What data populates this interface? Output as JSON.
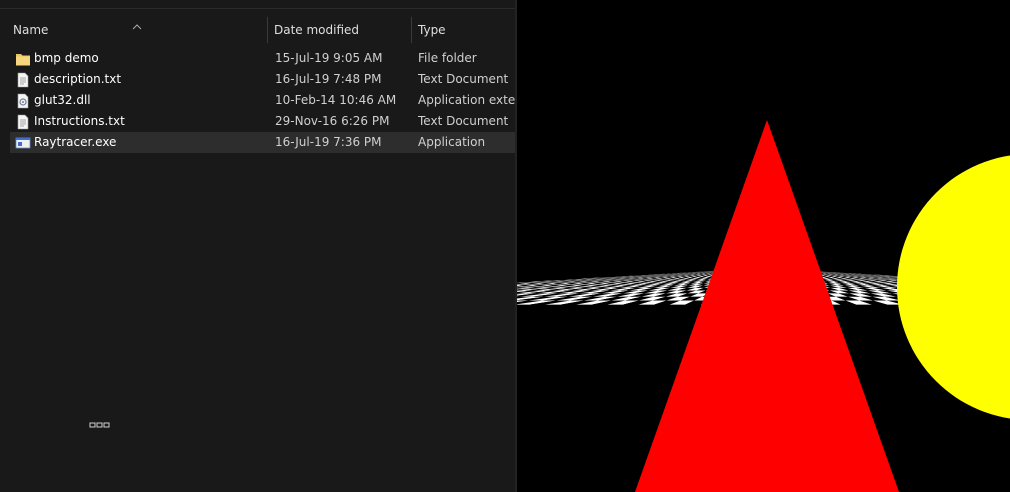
{
  "explorer": {
    "columns": {
      "name": "Name",
      "date": "Date modified",
      "type": "Type"
    },
    "files": [
      {
        "icon": "folder-icon",
        "name": "bmp demo",
        "date": "15-Jul-19 9:05 AM",
        "type": "File folder",
        "selected": false
      },
      {
        "icon": "text-file-icon",
        "name": "description.txt",
        "date": "16-Jul-19 7:48 PM",
        "type": "Text Document",
        "selected": false
      },
      {
        "icon": "dll-file-icon",
        "name": "glut32.dll",
        "date": "10-Feb-14 10:46 AM",
        "type": "Application exten...",
        "selected": false
      },
      {
        "icon": "text-file-icon",
        "name": "Instructions.txt",
        "date": "29-Nov-16 6:26 PM",
        "type": "Text Document",
        "selected": false
      },
      {
        "icon": "exe-file-icon",
        "name": "Raytracer.exe",
        "date": "16-Jul-19 7:36 PM",
        "type": "Application",
        "selected": true
      }
    ]
  },
  "render_window": {
    "background_color": "#000000",
    "floor_colors": [
      "#ffffff",
      "#000000"
    ],
    "cone_color": "#ff0000",
    "sphere_color": "#ffff00"
  }
}
